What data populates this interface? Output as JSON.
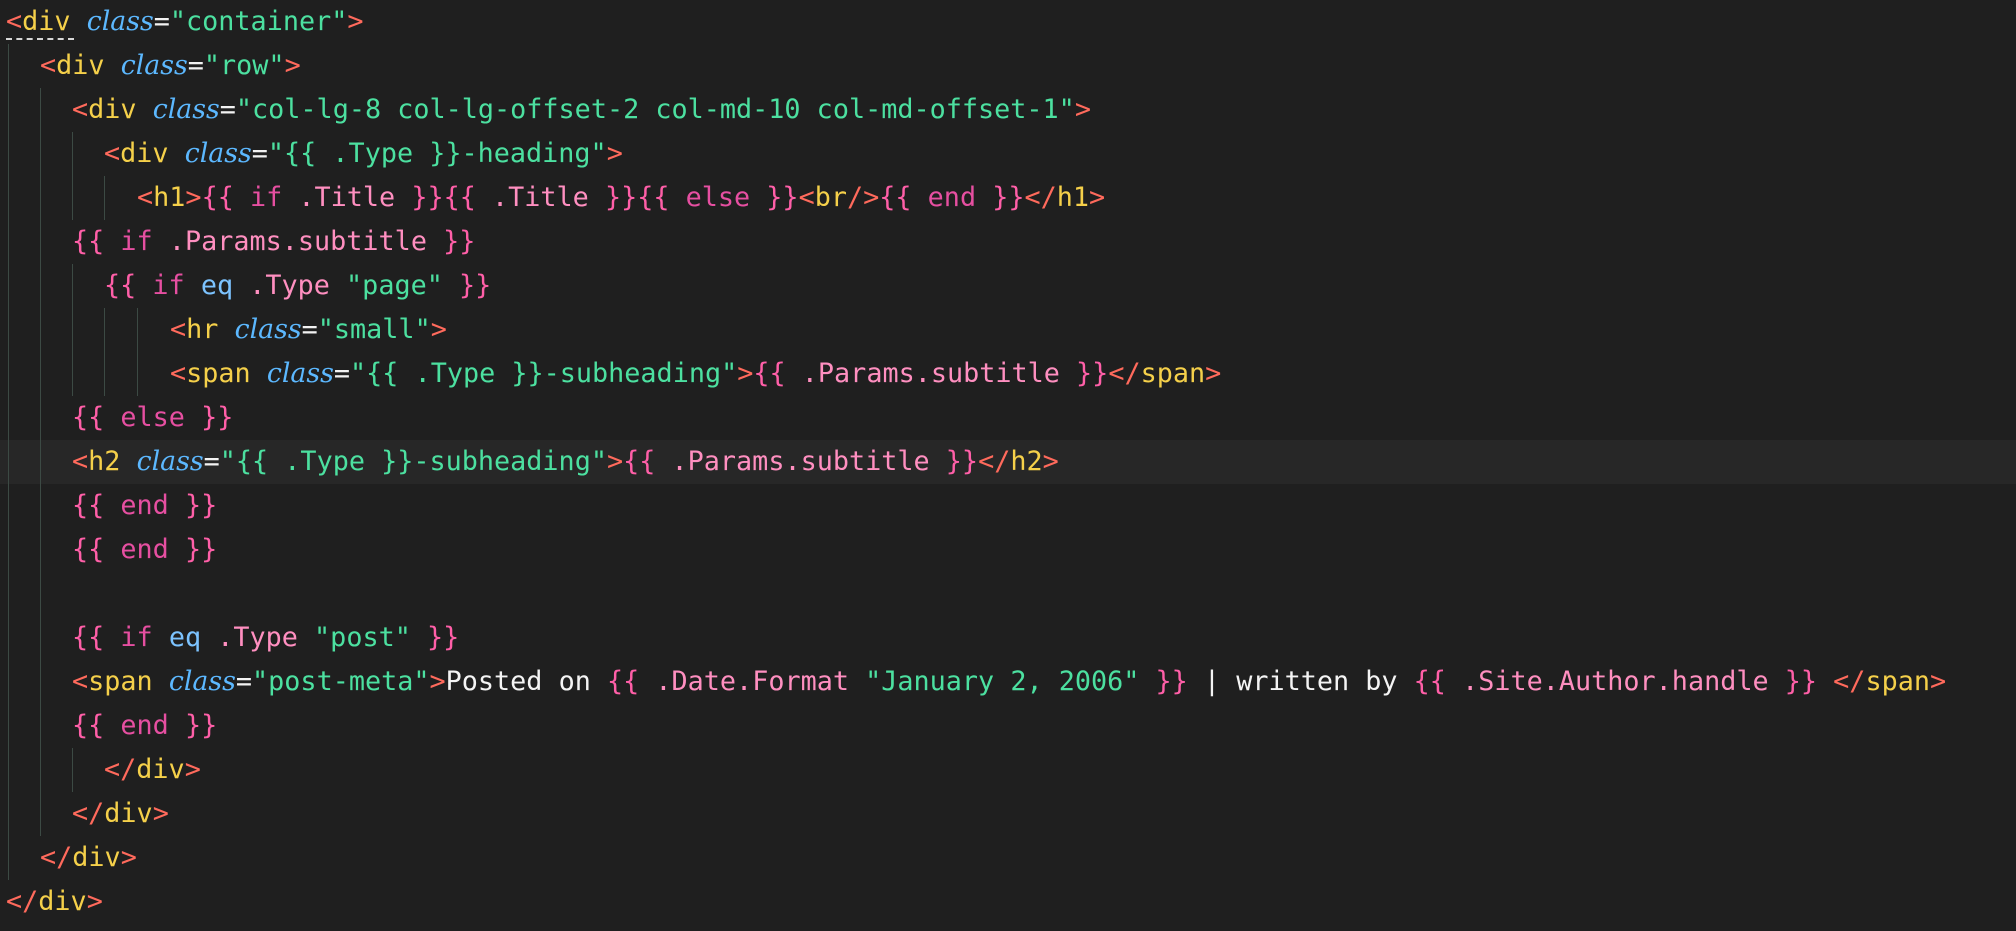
{
  "editor": {
    "language": "html",
    "active_line": 10,
    "colors": {
      "background": "#1f1f1f",
      "active_line": "#272727",
      "punctuation": "#ff6a5c",
      "tag": "#f5d04a",
      "attribute": "#5cb8ff",
      "string": "#4ce0a0",
      "template": "#ff5fa8",
      "keyword": "#e64fa1",
      "function": "#7cc3ff",
      "text": "#f4f4f4"
    },
    "lines": [
      {
        "tokens": [
          [
            "tk-punct",
            "<"
          ],
          [
            "tk-tag",
            "div"
          ],
          [
            "tk-text",
            " "
          ],
          [
            "tk-attr",
            "class"
          ],
          [
            "tk-eq",
            "="
          ],
          [
            "tk-string",
            "\"container\""
          ],
          [
            "tk-punct",
            ">"
          ]
        ]
      },
      {
        "tokens": [
          [
            "tk-punct",
            "<"
          ],
          [
            "tk-tag",
            "div"
          ],
          [
            "tk-text",
            " "
          ],
          [
            "tk-attr",
            "class"
          ],
          [
            "tk-eq",
            "="
          ],
          [
            "tk-string",
            "\"row\""
          ],
          [
            "tk-punct",
            ">"
          ]
        ]
      },
      {
        "tokens": [
          [
            "tk-punct",
            "<"
          ],
          [
            "tk-tag",
            "div"
          ],
          [
            "tk-text",
            " "
          ],
          [
            "tk-attr",
            "class"
          ],
          [
            "tk-eq",
            "="
          ],
          [
            "tk-string",
            "\"col-lg-8 col-lg-offset-2 col-md-10 col-md-offset-1\""
          ],
          [
            "tk-punct",
            ">"
          ]
        ]
      },
      {
        "tokens": [
          [
            "tk-punct",
            "<"
          ],
          [
            "tk-tag",
            "div"
          ],
          [
            "tk-text",
            " "
          ],
          [
            "tk-attr",
            "class"
          ],
          [
            "tk-eq",
            "="
          ],
          [
            "tk-string",
            "\"{{ .Type }}-heading\""
          ],
          [
            "tk-punct",
            ">"
          ]
        ]
      },
      {
        "tokens": [
          [
            "tk-punct",
            "<"
          ],
          [
            "tk-tag",
            "h1"
          ],
          [
            "tk-punct",
            ">"
          ],
          [
            "tk-tmpl",
            "{{ "
          ],
          [
            "tk-kw",
            "if"
          ],
          [
            "tk-field",
            " .Title "
          ],
          [
            "tk-tmpl",
            "}}{{ "
          ],
          [
            "tk-field",
            ".Title "
          ],
          [
            "tk-tmpl",
            "}}{{ "
          ],
          [
            "tk-kw",
            "else"
          ],
          [
            "tk-tmpl",
            " }}"
          ],
          [
            "tk-punct",
            "<"
          ],
          [
            "tk-tag",
            "br"
          ],
          [
            "tk-punct",
            "/>"
          ],
          [
            "tk-tmpl",
            "{{ "
          ],
          [
            "tk-kw",
            "end"
          ],
          [
            "tk-tmpl",
            " }}"
          ],
          [
            "tk-punct",
            "</"
          ],
          [
            "tk-tag",
            "h1"
          ],
          [
            "tk-punct",
            ">"
          ]
        ]
      },
      {
        "tokens": [
          [
            "tk-tmpl",
            "{{ "
          ],
          [
            "tk-kw",
            "if"
          ],
          [
            "tk-field",
            " .Params.subtitle "
          ],
          [
            "tk-tmpl",
            "}}"
          ]
        ]
      },
      {
        "tokens": [
          [
            "tk-tmpl",
            "{{ "
          ],
          [
            "tk-kw",
            "if"
          ],
          [
            "tk-text",
            " "
          ],
          [
            "tk-func",
            "eq"
          ],
          [
            "tk-field",
            " .Type "
          ],
          [
            "tk-string",
            "\"page\""
          ],
          [
            "tk-tmpl",
            " }}"
          ]
        ]
      },
      {
        "tokens": [
          [
            "tk-punct",
            "<"
          ],
          [
            "tk-tag",
            "hr"
          ],
          [
            "tk-text",
            " "
          ],
          [
            "tk-attr",
            "class"
          ],
          [
            "tk-eq",
            "="
          ],
          [
            "tk-string",
            "\"small\""
          ],
          [
            "tk-punct",
            ">"
          ]
        ]
      },
      {
        "tokens": [
          [
            "tk-punct",
            "<"
          ],
          [
            "tk-tag",
            "span"
          ],
          [
            "tk-text",
            " "
          ],
          [
            "tk-attr",
            "class"
          ],
          [
            "tk-eq",
            "="
          ],
          [
            "tk-string",
            "\"{{ .Type }}-subheading\""
          ],
          [
            "tk-punct",
            ">"
          ],
          [
            "tk-tmpl",
            "{{ "
          ],
          [
            "tk-field",
            ".Params.subtitle "
          ],
          [
            "tk-tmpl",
            "}}"
          ],
          [
            "tk-punct",
            "</"
          ],
          [
            "tk-tag",
            "span"
          ],
          [
            "tk-punct",
            ">"
          ]
        ]
      },
      {
        "tokens": [
          [
            "tk-tmpl",
            "{{ "
          ],
          [
            "tk-kw",
            "else"
          ],
          [
            "tk-tmpl",
            " }}"
          ]
        ]
      },
      {
        "tokens": [
          [
            "tk-punct",
            "<"
          ],
          [
            "tk-tag",
            "h2"
          ],
          [
            "tk-text",
            " "
          ],
          [
            "tk-attr",
            "class"
          ],
          [
            "tk-eq",
            "="
          ],
          [
            "tk-string",
            "\"{{ .Type }}-subheading\""
          ],
          [
            "tk-punct",
            ">"
          ],
          [
            "tk-tmpl",
            "{{ "
          ],
          [
            "tk-field",
            ".Params.subtitle "
          ],
          [
            "tk-tmpl",
            "}}"
          ],
          [
            "tk-punct",
            "</"
          ],
          [
            "tk-tag",
            "h2"
          ],
          [
            "tk-punct",
            ">"
          ]
        ]
      },
      {
        "tokens": [
          [
            "tk-tmpl",
            "{{ "
          ],
          [
            "tk-kw",
            "end"
          ],
          [
            "tk-tmpl",
            " }}"
          ]
        ]
      },
      {
        "tokens": [
          [
            "tk-tmpl",
            "{{ "
          ],
          [
            "tk-kw",
            "end"
          ],
          [
            "tk-tmpl",
            " }}"
          ]
        ]
      },
      {
        "tokens": []
      },
      {
        "tokens": [
          [
            "tk-tmpl",
            "{{ "
          ],
          [
            "tk-kw",
            "if"
          ],
          [
            "tk-text",
            " "
          ],
          [
            "tk-func",
            "eq"
          ],
          [
            "tk-field",
            " .Type "
          ],
          [
            "tk-string",
            "\"post\""
          ],
          [
            "tk-tmpl",
            " }}"
          ]
        ]
      },
      {
        "tokens": [
          [
            "tk-punct",
            "<"
          ],
          [
            "tk-tag",
            "span"
          ],
          [
            "tk-text",
            " "
          ],
          [
            "tk-attr",
            "class"
          ],
          [
            "tk-eq",
            "="
          ],
          [
            "tk-string",
            "\"post-meta\""
          ],
          [
            "tk-punct",
            ">"
          ],
          [
            "tk-text",
            "Posted on "
          ],
          [
            "tk-tmpl",
            "{{ "
          ],
          [
            "tk-field",
            ".Date.Format "
          ],
          [
            "tk-string",
            "\"January 2, 2006\""
          ],
          [
            "tk-tmpl",
            " }}"
          ],
          [
            "tk-text",
            " | written by "
          ],
          [
            "tk-tmpl",
            "{{ "
          ],
          [
            "tk-field",
            ".Site.Author.handle "
          ],
          [
            "tk-tmpl",
            "}}"
          ],
          [
            "tk-text",
            " "
          ],
          [
            "tk-punct",
            "</"
          ],
          [
            "tk-tag",
            "span"
          ],
          [
            "tk-punct",
            ">"
          ]
        ]
      },
      {
        "tokens": [
          [
            "tk-tmpl",
            "{{ "
          ],
          [
            "tk-kw",
            "end"
          ],
          [
            "tk-tmpl",
            " }}"
          ]
        ]
      },
      {
        "tokens": [
          [
            "tk-punct",
            "</"
          ],
          [
            "tk-tag",
            "div"
          ],
          [
            "tk-punct",
            ">"
          ]
        ]
      },
      {
        "tokens": [
          [
            "tk-punct",
            "</"
          ],
          [
            "tk-tag",
            "div"
          ],
          [
            "tk-punct",
            ">"
          ]
        ]
      },
      {
        "tokens": [
          [
            "tk-punct",
            "</"
          ],
          [
            "tk-tag",
            "div"
          ],
          [
            "tk-punct",
            ">"
          ]
        ]
      },
      {
        "tokens": [
          [
            "tk-punct",
            "</"
          ],
          [
            "tk-tag",
            "div"
          ],
          [
            "tk-punct",
            ">"
          ]
        ]
      }
    ]
  }
}
